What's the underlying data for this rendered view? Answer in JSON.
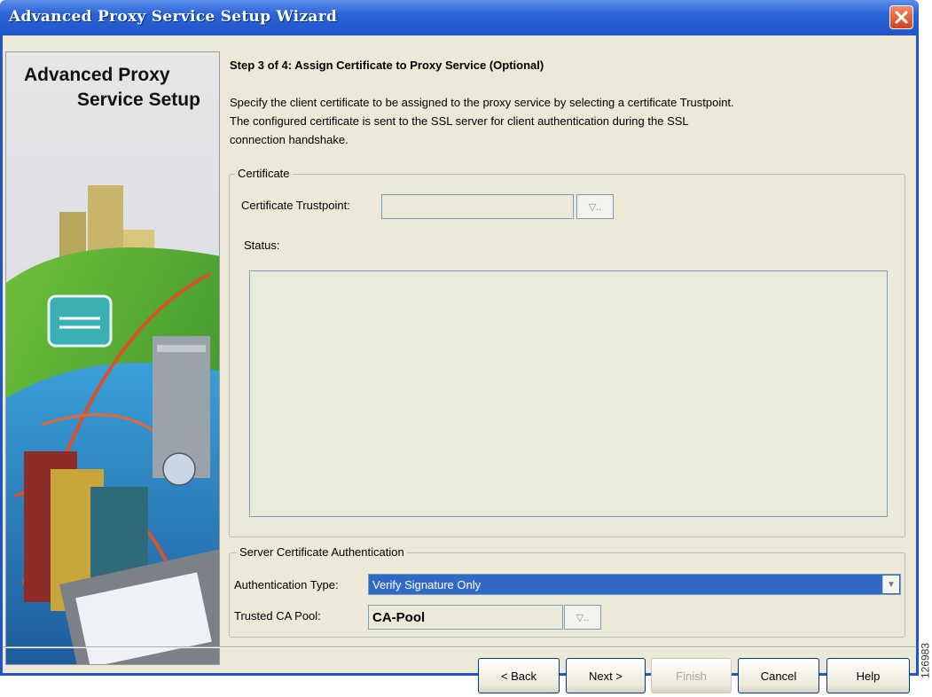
{
  "window": {
    "title": "Advanced Proxy Service Setup Wizard"
  },
  "banner": {
    "line1": "Advanced Proxy",
    "line2": "Service Setup"
  },
  "step": {
    "title": "Step 3 of 4: Assign Certificate to Proxy Service (Optional)",
    "description": "Specify the client certificate to be assigned to the proxy service by selecting a certificate Trustpoint. The configured certificate is sent to the SSL server for client authentication during the SSL connection handshake."
  },
  "certificate": {
    "group_label": "Certificate",
    "trustpoint_label": "Certificate Trustpoint:",
    "trustpoint_value": "",
    "browse_glyph": "▽..",
    "status_label": "Status:",
    "status_text": ""
  },
  "server_auth": {
    "group_label": "Server Certificate Authentication",
    "auth_type_label": "Authentication Type:",
    "auth_type_value": "Verify Signature Only",
    "ca_pool_label": "Trusted CA Pool:",
    "ca_pool_value": "CA-Pool",
    "browse_glyph": "▽.."
  },
  "buttons": {
    "back": "< Back",
    "next": "Next >",
    "finish": "Finish",
    "cancel": "Cancel",
    "help": "Help"
  },
  "figure_id": "126983",
  "icons": {
    "close": "close-icon",
    "dropdown": "chevron-down-icon"
  },
  "colors": {
    "titlebar": "#2a64d8",
    "selection": "#3169c6",
    "dialog_bg": "#ece9d8"
  }
}
